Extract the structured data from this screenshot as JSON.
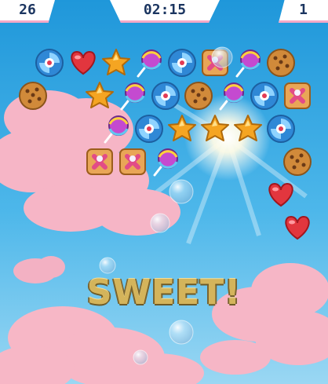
{
  "hud": {
    "left_value": "26",
    "timer": "02:15",
    "right_value": "1"
  },
  "banner": {
    "text": "SWEET!"
  },
  "board": {
    "rows": [
      [
        "peppermint",
        "heart",
        "star",
        "lollipop",
        "peppermint",
        "cracker",
        "lollipop",
        "cookie"
      ],
      [
        "cookie",
        "star",
        "lollipop",
        "peppermint",
        "cookie",
        "lollipop",
        "peppermint",
        "cracker"
      ],
      [
        "lollipop",
        "peppermint",
        "star",
        "star",
        "star",
        "peppermint"
      ],
      [
        "cracker",
        "cracker",
        "lollipop",
        "cookie"
      ],
      [
        "heart"
      ],
      [
        "heart"
      ]
    ]
  },
  "colors": {
    "sky_top": "#2aa6e2",
    "sky_bottom": "#8bd3f2",
    "cloud": "#f6b4c4",
    "hud_bg": "#ffffff",
    "hud_text": "#1b3560",
    "banner_gold": "#d4b45b"
  }
}
